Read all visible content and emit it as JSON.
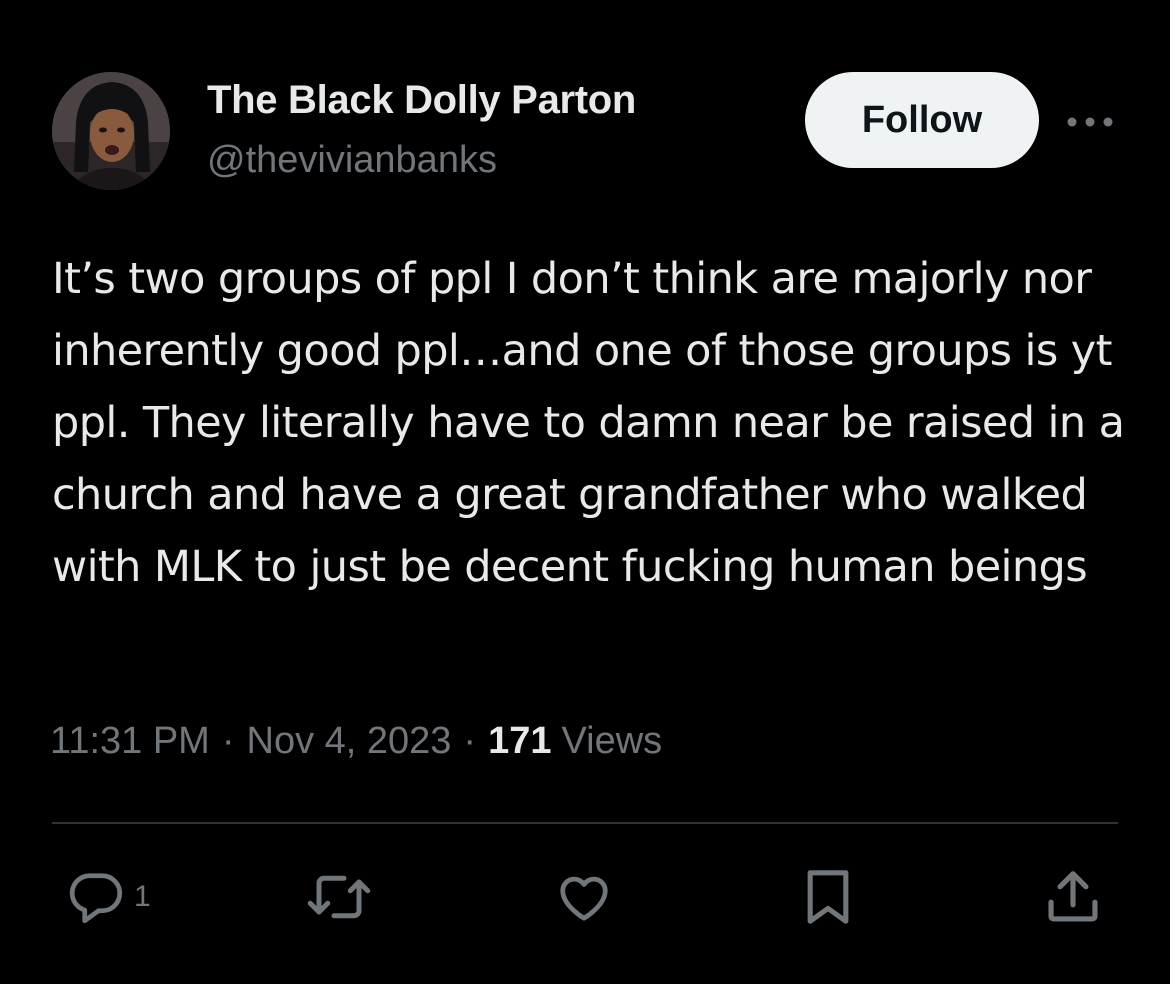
{
  "author": {
    "name": "The Black Dolly Parton",
    "handle": "@thevivianbanks",
    "avatar_icon": "profile-photo"
  },
  "follow_button": {
    "label": "Follow"
  },
  "more_menu": {
    "icon": "more-horizontal-icon"
  },
  "tweet": {
    "text": "It’s two groups of ppl I don’t think are majorly nor inherently good ppl…and one of those groups is yt ppl. They literally have to damn near be raised in a church and have a great grandfather who walked with MLK to just be decent fucking human beings"
  },
  "meta": {
    "time": "11:31 PM",
    "separator": "·",
    "date": "Nov 4, 2023",
    "views_count": "171",
    "views_label": "Views"
  },
  "actions": {
    "reply": {
      "icon": "reply-icon",
      "count": "1"
    },
    "retweet": {
      "icon": "retweet-icon"
    },
    "like": {
      "icon": "heart-icon"
    },
    "bookmark": {
      "icon": "bookmark-icon"
    },
    "share": {
      "icon": "share-icon"
    }
  },
  "colors": {
    "background": "#000000",
    "primary_text": "#e7e9ea",
    "secondary_text": "#71767b",
    "divider": "#2f3336",
    "follow_button_bg": "#eff3f4",
    "follow_button_text": "#0f1419"
  }
}
